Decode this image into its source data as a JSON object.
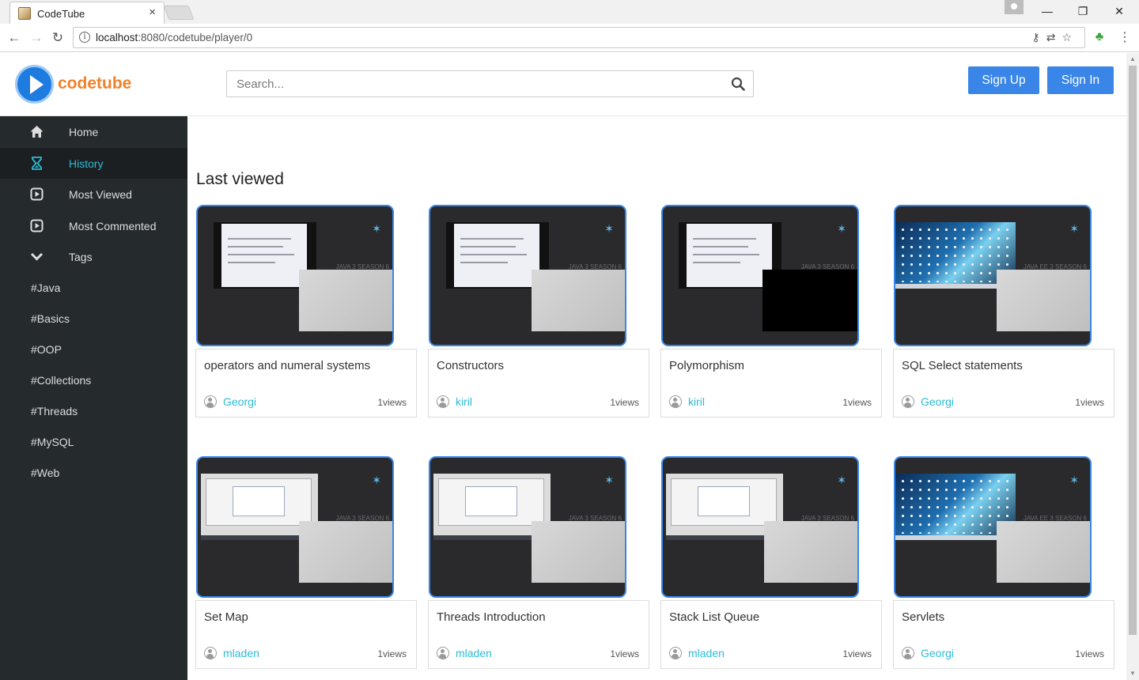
{
  "browser": {
    "tab_title": "CodeTube",
    "tab_close": "×",
    "url_host": "localhost",
    "url_rest": ":8080/codetube/player/0",
    "omni_info": "i",
    "window_buttons": [
      "—",
      "❐",
      "✕"
    ]
  },
  "header": {
    "logo_text": "codetube",
    "search_placeholder": "Search...",
    "signup_label": "Sign Up",
    "signin_label": "Sign In"
  },
  "sidebar": {
    "items": [
      {
        "label": "Home",
        "icon": "home-icon"
      },
      {
        "label": "History",
        "icon": "hourglass-icon",
        "active": true
      },
      {
        "label": "Most Viewed",
        "icon": "play-square-icon"
      },
      {
        "label": "Most Commented",
        "icon": "play-square-icon"
      },
      {
        "label": "Tags",
        "icon": "chevron-down-icon"
      }
    ],
    "tags": [
      "#Java",
      "#Basics",
      "#OOP",
      "#Collections",
      "#Threads",
      "#MySQL",
      "#Web"
    ]
  },
  "main": {
    "section_title": "Last viewed",
    "videos": [
      {
        "title": "operators and numeral systems",
        "author": "Georgi",
        "views": "1views",
        "thumb": "slide",
        "season": "JAVA 3 SEASON 6"
      },
      {
        "title": "Constructors",
        "author": "kiril",
        "views": "1views",
        "thumb": "slide",
        "season": "JAVA 3 SEASON 6"
      },
      {
        "title": "Polymorphism",
        "author": "kiril",
        "views": "1views",
        "thumb": "slide-black",
        "season": "JAVA 3 SEASON 6"
      },
      {
        "title": "SQL Select statements",
        "author": "Georgi",
        "views": "1views",
        "thumb": "desktop",
        "season": "JAVA EE 3 SEASON 6"
      },
      {
        "title": "Set Map",
        "author": "mladen",
        "views": "1views",
        "thumb": "screen",
        "season": "JAVA 3 SEASON 6"
      },
      {
        "title": "Threads Introduction",
        "author": "mladen",
        "views": "1views",
        "thumb": "screen-slide",
        "season": "JAVA 3 SEASON 6"
      },
      {
        "title": "Stack List Queue",
        "author": "mladen",
        "views": "1views",
        "thumb": "screen",
        "season": "JAVA 3 SEASON 6"
      },
      {
        "title": "Servlets",
        "author": "Georgi",
        "views": "1views",
        "thumb": "desktop",
        "season": "JAVA EE 3 SEASON 6"
      }
    ]
  },
  "colors": {
    "accent": "#3a86e8",
    "logo_orange": "#f0812b",
    "link_cyan": "#2bbcd6",
    "sidebar_bg": "#252a2d"
  }
}
